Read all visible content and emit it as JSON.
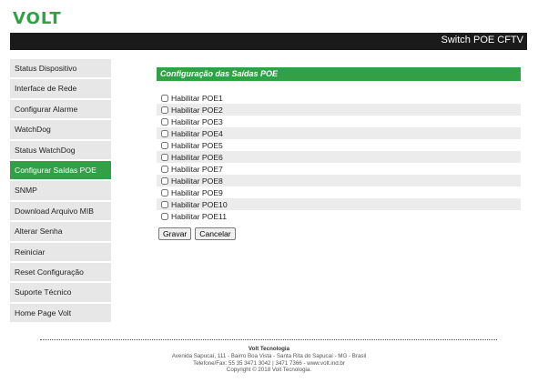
{
  "brand": {
    "logo_text": "VOLT",
    "logo_color": "#33a047"
  },
  "header": {
    "title": "Switch POE CFTV"
  },
  "sidebar": {
    "items": [
      {
        "label": "Status Dispositivo"
      },
      {
        "label": "Interface de Rede"
      },
      {
        "label": "Configurar Alarme"
      },
      {
        "label": "WatchDog"
      },
      {
        "label": "Status WatchDog"
      },
      {
        "label": "Configurar Saídas POE",
        "active": true
      },
      {
        "label": "SNMP"
      },
      {
        "label": "Download Arquivo MIB"
      },
      {
        "label": "Alterar Senha"
      },
      {
        "label": "Reiniciar"
      },
      {
        "label": "Reset Configuração"
      },
      {
        "label": "Suporte Técnico"
      },
      {
        "label": "Home Page Volt"
      }
    ]
  },
  "main": {
    "section_title": "Configuração das Saídas POE",
    "poe_items": [
      {
        "label": "Habilitar POE1",
        "checked": false
      },
      {
        "label": "Habilitar POE2",
        "checked": false
      },
      {
        "label": "Habilitar POE3",
        "checked": false
      },
      {
        "label": "Habilitar POE4",
        "checked": false
      },
      {
        "label": "Habilitar POE5",
        "checked": false
      },
      {
        "label": "Habilitar POE6",
        "checked": false
      },
      {
        "label": "Habilitar POE7",
        "checked": false
      },
      {
        "label": "Habilitar POE8",
        "checked": false
      },
      {
        "label": "Habilitar POE9",
        "checked": false
      },
      {
        "label": "Habilitar POE10",
        "checked": false
      },
      {
        "label": "Habilitar POE11",
        "checked": false
      }
    ],
    "save_label": "Gravar",
    "cancel_label": "Cancelar"
  },
  "footer": {
    "company": "Volt Tecnologia",
    "address": "Avenida Sapucaí, 111 - Bairro Boa Vista - Santa Rita do Sapucaí - MG - Brasil",
    "phone": "Telefone/Fax: 55 35 3471 3042 | 3471 7366 - www.volt.ind.br",
    "copyright": "Copyright © 2018 Volt Tecnologia."
  }
}
